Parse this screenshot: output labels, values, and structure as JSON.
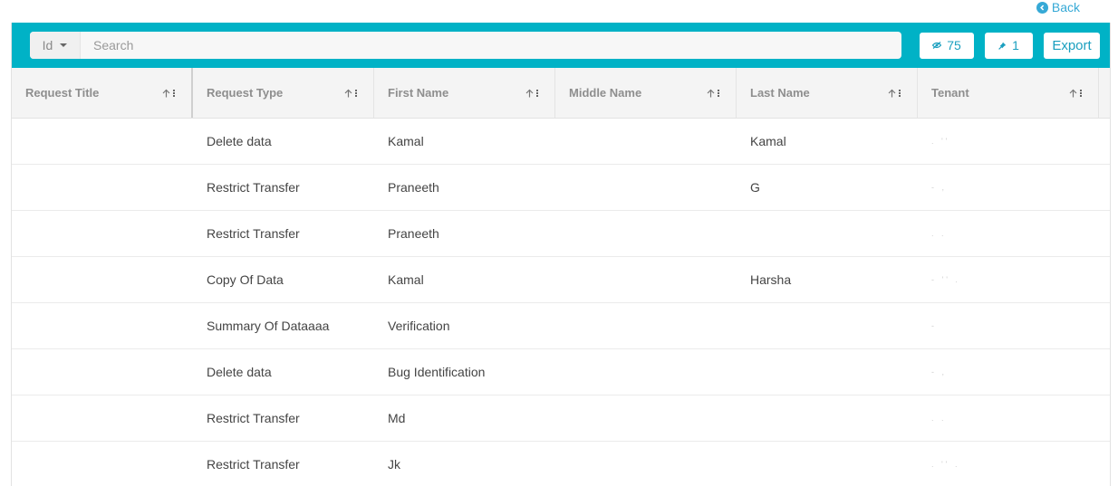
{
  "back": {
    "label": "Back"
  },
  "toolbar": {
    "filter_select": "Id",
    "search_placeholder": "Search",
    "views_count": "75",
    "pins_count": "1",
    "export_label": "Export"
  },
  "columns": [
    {
      "key": "request_title",
      "label": "Request Title"
    },
    {
      "key": "request_type",
      "label": "Request Type"
    },
    {
      "key": "first_name",
      "label": "First Name"
    },
    {
      "key": "middle_name",
      "label": "Middle Name"
    },
    {
      "key": "last_name",
      "label": "Last Name"
    },
    {
      "key": "tenant",
      "label": "Tenant"
    }
  ],
  "rows": [
    {
      "request_title": "",
      "request_type": "Delete data",
      "first_name": "Kamal",
      "middle_name": "",
      "last_name": "Kamal",
      "tenant": ". ''"
    },
    {
      "request_title": "",
      "request_type": "Restrict Transfer",
      "first_name": "Praneeth",
      "middle_name": "",
      "last_name": "G",
      "tenant": "- ,"
    },
    {
      "request_title": "",
      "request_type": "Restrict Transfer",
      "first_name": "Praneeth",
      "middle_name": "",
      "last_name": "",
      "tenant": ". ."
    },
    {
      "request_title": "",
      "request_type": "Copy Of Data",
      "first_name": "Kamal",
      "middle_name": "",
      "last_name": "Harsha",
      "tenant": "- '' ."
    },
    {
      "request_title": "",
      "request_type": "Summary Of Dataaaa",
      "first_name": "Verification",
      "middle_name": "",
      "last_name": "",
      "tenant": "-"
    },
    {
      "request_title": "",
      "request_type": "Delete data",
      "first_name": "Bug Identification",
      "middle_name": "",
      "last_name": "",
      "tenant": "- ,"
    },
    {
      "request_title": "",
      "request_type": "Restrict Transfer",
      "first_name": "Md",
      "middle_name": "",
      "last_name": "",
      "tenant": ". ."
    },
    {
      "request_title": "",
      "request_type": "Restrict Transfer",
      "first_name": "Jk",
      "middle_name": "",
      "last_name": "",
      "tenant": ". '' ."
    }
  ],
  "colors": {
    "accent": "#00b2c6",
    "link": "#36a9d6",
    "header_bg": "#f4f4f4"
  },
  "icons": {
    "back": "chevron-left-circle-icon",
    "views": "eye-off-icon",
    "pins": "pin-icon",
    "sort": "arrow-up-icon",
    "menu": "kebab-menu-icon"
  }
}
